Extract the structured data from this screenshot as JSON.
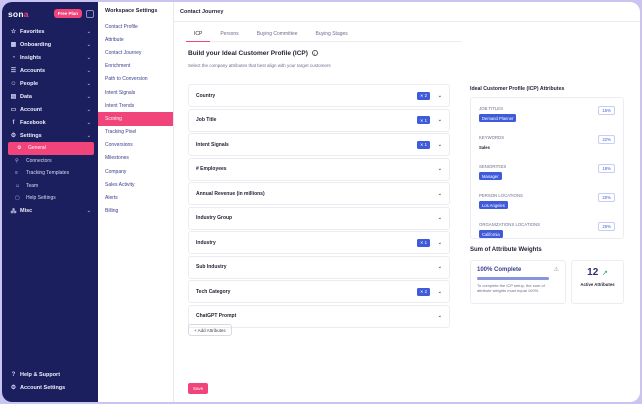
{
  "sidebar": {
    "logo": "sona",
    "badge": "Free Plan",
    "items": [
      {
        "label": "Favorites",
        "icon": "star-icon",
        "glyph": "☆"
      },
      {
        "label": "Onboarding",
        "icon": "grid-icon",
        "glyph": "▦"
      },
      {
        "label": "Insights",
        "icon": "bulb-icon",
        "glyph": "◔"
      },
      {
        "label": "Accounts",
        "icon": "list-icon",
        "glyph": "☰"
      },
      {
        "label": "People",
        "icon": "users-icon",
        "glyph": "☺"
      },
      {
        "label": "Data",
        "icon": "database-icon",
        "glyph": "▤"
      },
      {
        "label": "Account",
        "icon": "briefcase-icon",
        "glyph": "▭"
      },
      {
        "label": "Facebook",
        "icon": "facebook-icon",
        "glyph": "f"
      },
      {
        "label": "Settings",
        "icon": "gear-icon",
        "glyph": "⚙"
      }
    ],
    "settings_items": [
      {
        "label": "General",
        "icon": "gear-icon",
        "glyph": "⚙"
      },
      {
        "label": "Connectors",
        "icon": "link-icon",
        "glyph": "⚲"
      },
      {
        "label": "Tracking Templates",
        "icon": "template-icon",
        "glyph": "≡"
      },
      {
        "label": "Team",
        "icon": "team-icon",
        "glyph": "☺"
      },
      {
        "label": "Help Settings",
        "icon": "help-settings-icon",
        "glyph": "▢"
      }
    ],
    "misc": "Misc",
    "help": "Help & Support",
    "account_settings": "Account Settings"
  },
  "workspace": {
    "title": "Workspace Settings",
    "items": [
      "Contact Profile",
      "Attribute",
      "Contact Journey",
      "Enrichment",
      "Path to Conversion",
      "Intent Signals",
      "Intent Trends",
      "Scoring",
      "Tracking Pixel",
      "Conversions",
      "Milestones",
      "Company",
      "Sales Activity",
      "Alerts",
      "Billing"
    ]
  },
  "header": {
    "title": "Contact Journey"
  },
  "tabs": [
    "ICP",
    "Persons",
    "Buying Committee",
    "Buying Stages"
  ],
  "main": {
    "title": "Build your Ideal Customer Profile (ICP)",
    "subtitle": "Select the company attributes that best align with your target customers",
    "attributes": [
      {
        "label": "Country",
        "count": "✕ 2"
      },
      {
        "label": "Job Title",
        "count": "✕ 1"
      },
      {
        "label": "Intent Signals",
        "count": "✕ 1"
      },
      {
        "label": "# Employees",
        "count": ""
      },
      {
        "label": "Annual Revenue (in millions)",
        "count": ""
      },
      {
        "label": "Industry Group",
        "count": ""
      },
      {
        "label": "Industry",
        "count": "✕ 1"
      },
      {
        "label": "Sub Industry",
        "count": ""
      },
      {
        "label": "Tech Category",
        "count": "✕ 2"
      },
      {
        "label": "ChatGPT Prompt",
        "count": ""
      }
    ],
    "add_button": "+ Add Attributes",
    "save_button": "Save"
  },
  "icp_panel": {
    "title": "Ideal Customer Profile (ICP) Attributes",
    "groups": [
      {
        "label": "JOB TITLES",
        "pct": "15%",
        "value": "Demand Planner",
        "chip": true
      },
      {
        "label": "KEYWORDS",
        "pct": "22%",
        "value": "Sales",
        "chip": false
      },
      {
        "label": "SENIORITIES",
        "pct": "18%",
        "value": "Manager",
        "chip": true
      },
      {
        "label": "PERSON LOCATIONS",
        "pct": "20%",
        "value": "Los Angeles",
        "chip": true
      },
      {
        "label": "ORGANIZATIONS LOCATIONS",
        "pct": "25%",
        "value": "California",
        "chip": true
      }
    ]
  },
  "weights": {
    "title": "Sum of Attribute Weights",
    "complete": "100% Complete",
    "progress": 1.0,
    "note": "To complete the ICP setup, the sum of attribute weights must equal 100%.",
    "active_count": "12",
    "active_label": "Active Attributes"
  }
}
